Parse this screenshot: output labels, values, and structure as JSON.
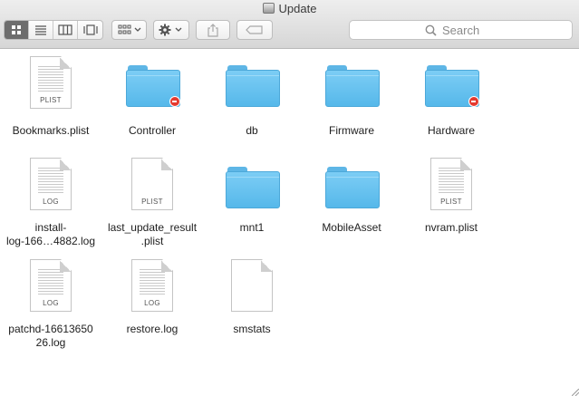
{
  "window": {
    "title": "Update",
    "title_icon": "disk-drive-icon"
  },
  "toolbar": {
    "view_modes": [
      {
        "name": "icon-view",
        "icon": "grid-icon",
        "active": true
      },
      {
        "name": "list-view",
        "icon": "list-icon",
        "active": false
      },
      {
        "name": "column-view",
        "icon": "columns-icon",
        "active": false
      },
      {
        "name": "cover-flow-view",
        "icon": "cover-flow-icon",
        "active": false
      }
    ],
    "arrange_icon": "group-by-icon",
    "action_icon": "gear-icon",
    "share_icon": "share-icon",
    "tags_icon": "tag-icon",
    "search": {
      "placeholder": "Search",
      "value": ""
    }
  },
  "colors": {
    "folder": "#5eb6e6",
    "badge": "#e53a2f",
    "active_segment": "#6d6d6d"
  },
  "items": [
    {
      "name": "Bookmarks.plist",
      "kind": "document",
      "tag": "PLIST"
    },
    {
      "name": "Controller",
      "kind": "folder",
      "locked": true
    },
    {
      "name": "db",
      "kind": "folder",
      "locked": false
    },
    {
      "name": "Firmware",
      "kind": "folder",
      "locked": false
    },
    {
      "name": "Hardware",
      "kind": "folder",
      "locked": true
    },
    {
      "name": "install-\nlog-166…4882.log",
      "kind": "document",
      "tag": "LOG"
    },
    {
      "name": "last_update_result\n.plist",
      "kind": "document",
      "tag": "PLIST",
      "blank": true
    },
    {
      "name": "mnt1",
      "kind": "folder",
      "locked": false
    },
    {
      "name": "MobileAsset",
      "kind": "folder",
      "locked": false
    },
    {
      "name": "nvram.plist",
      "kind": "document",
      "tag": "PLIST"
    },
    {
      "name": "patchd-16613650\n26.log",
      "kind": "document",
      "tag": "LOG"
    },
    {
      "name": "restore.log",
      "kind": "document",
      "tag": "LOG"
    },
    {
      "name": "smstats",
      "kind": "document",
      "tag": "",
      "blank": true
    }
  ]
}
